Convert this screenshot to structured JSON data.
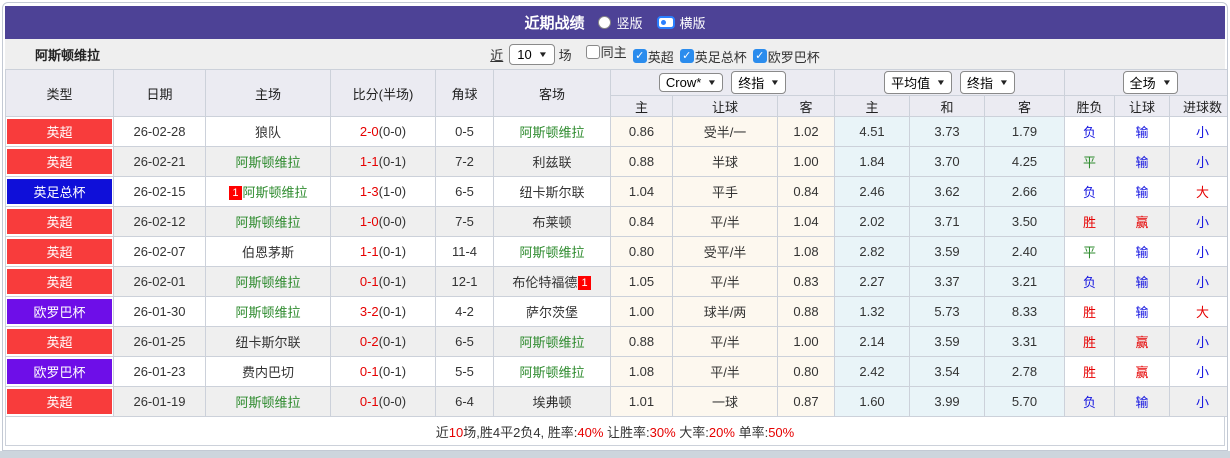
{
  "header": {
    "title": "近期战绩",
    "radios": [
      {
        "label": "竖版",
        "selected": false
      },
      {
        "label": "横版",
        "selected": true
      }
    ]
  },
  "filter": {
    "team": "阿斯顿维拉",
    "near_label": "近",
    "match_count": "10",
    "games_label": "场",
    "checkboxes": [
      {
        "label": "同主",
        "checked": false
      },
      {
        "label": "英超",
        "checked": true
      },
      {
        "label": "英足总杯",
        "checked": true
      },
      {
        "label": "欧罗巴杯",
        "checked": true
      }
    ]
  },
  "table": {
    "main_headers": [
      "类型",
      "日期",
      "主场",
      "比分(半场)",
      "角球",
      "客场"
    ],
    "selects": [
      {
        "label": "Crow*"
      },
      {
        "label": "终指"
      },
      {
        "label": "平均值"
      },
      {
        "label": "终指"
      },
      {
        "label": "全场"
      }
    ],
    "sub_headers": [
      "主",
      "让球",
      "客",
      "主",
      "和",
      "客",
      "胜负",
      "让球",
      "进球数"
    ],
    "rows": [
      {
        "type": "英超",
        "date": "26-02-28",
        "home": {
          "name": "狼队",
          "villa": false,
          "card": null
        },
        "score": {
          "ft": "2-0",
          "ht": "(0-0)"
        },
        "corner": "0-5",
        "away": {
          "name": "阿斯顿维拉",
          "villa": true,
          "card": null
        },
        "crow": [
          "0.86",
          "受半/一",
          "1.02"
        ],
        "avg": [
          "4.51",
          "3.73",
          "1.79"
        ],
        "result": [
          {
            "t": "负",
            "c": "blue"
          },
          {
            "t": "输",
            "c": "blue"
          },
          {
            "t": "小",
            "c": "blue"
          }
        ]
      },
      {
        "type": "英超",
        "date": "26-02-21",
        "home": {
          "name": "阿斯顿维拉",
          "villa": true,
          "card": null
        },
        "score": {
          "ft": "1-1",
          "ht": "(0-1)"
        },
        "corner": "7-2",
        "away": {
          "name": "利兹联",
          "villa": false,
          "card": null
        },
        "crow": [
          "0.88",
          "半球",
          "1.00"
        ],
        "avg": [
          "1.84",
          "3.70",
          "4.25"
        ],
        "result": [
          {
            "t": "平",
            "c": "green"
          },
          {
            "t": "输",
            "c": "blue"
          },
          {
            "t": "小",
            "c": "blue"
          }
        ]
      },
      {
        "type": "英足总杯",
        "date": "26-02-15",
        "home": {
          "name": "阿斯顿维拉",
          "villa": true,
          "card": "1"
        },
        "score": {
          "ft": "1-3",
          "ht": "(1-0)"
        },
        "corner": "6-5",
        "away": {
          "name": "纽卡斯尔联",
          "villa": false,
          "card": null
        },
        "crow": [
          "1.04",
          "平手",
          "0.84"
        ],
        "avg": [
          "2.46",
          "3.62",
          "2.66"
        ],
        "result": [
          {
            "t": "负",
            "c": "blue"
          },
          {
            "t": "输",
            "c": "blue"
          },
          {
            "t": "大",
            "c": "red"
          }
        ]
      },
      {
        "type": "英超",
        "date": "26-02-12",
        "home": {
          "name": "阿斯顿维拉",
          "villa": true,
          "card": null
        },
        "score": {
          "ft": "1-0",
          "ht": "(0-0)"
        },
        "corner": "7-5",
        "away": {
          "name": "布莱顿",
          "villa": false,
          "card": null
        },
        "crow": [
          "0.84",
          "平/半",
          "1.04"
        ],
        "avg": [
          "2.02",
          "3.71",
          "3.50"
        ],
        "result": [
          {
            "t": "胜",
            "c": "red"
          },
          {
            "t": "赢",
            "c": "red"
          },
          {
            "t": "小",
            "c": "blue"
          }
        ]
      },
      {
        "type": "英超",
        "date": "26-02-07",
        "home": {
          "name": "伯恩茅斯",
          "villa": false,
          "card": null
        },
        "score": {
          "ft": "1-1",
          "ht": "(0-1)"
        },
        "corner": "11-4",
        "away": {
          "name": "阿斯顿维拉",
          "villa": true,
          "card": null
        },
        "crow": [
          "0.80",
          "受平/半",
          "1.08"
        ],
        "avg": [
          "2.82",
          "3.59",
          "2.40"
        ],
        "result": [
          {
            "t": "平",
            "c": "green"
          },
          {
            "t": "输",
            "c": "blue"
          },
          {
            "t": "小",
            "c": "blue"
          }
        ]
      },
      {
        "type": "英超",
        "date": "26-02-01",
        "home": {
          "name": "阿斯顿维拉",
          "villa": true,
          "card": null
        },
        "score": {
          "ft": "0-1",
          "ht": "(0-1)"
        },
        "corner": "12-1",
        "away": {
          "name": "布伦特福德",
          "villa": false,
          "card": "1"
        },
        "crow": [
          "1.05",
          "平/半",
          "0.83"
        ],
        "avg": [
          "2.27",
          "3.37",
          "3.21"
        ],
        "result": [
          {
            "t": "负",
            "c": "blue"
          },
          {
            "t": "输",
            "c": "blue"
          },
          {
            "t": "小",
            "c": "blue"
          }
        ]
      },
      {
        "type": "欧罗巴杯",
        "date": "26-01-30",
        "home": {
          "name": "阿斯顿维拉",
          "villa": true,
          "card": null
        },
        "score": {
          "ft": "3-2",
          "ht": "(0-1)"
        },
        "corner": "4-2",
        "away": {
          "name": "萨尔茨堡",
          "villa": false,
          "card": null
        },
        "crow": [
          "1.00",
          "球半/两",
          "0.88"
        ],
        "avg": [
          "1.32",
          "5.73",
          "8.33"
        ],
        "result": [
          {
            "t": "胜",
            "c": "red"
          },
          {
            "t": "输",
            "c": "blue"
          },
          {
            "t": "大",
            "c": "red"
          }
        ]
      },
      {
        "type": "英超",
        "date": "26-01-25",
        "home": {
          "name": "纽卡斯尔联",
          "villa": false,
          "card": null
        },
        "score": {
          "ft": "0-2",
          "ht": "(0-1)"
        },
        "corner": "6-5",
        "away": {
          "name": "阿斯顿维拉",
          "villa": true,
          "card": null
        },
        "crow": [
          "0.88",
          "平/半",
          "1.00"
        ],
        "avg": [
          "2.14",
          "3.59",
          "3.31"
        ],
        "result": [
          {
            "t": "胜",
            "c": "red"
          },
          {
            "t": "赢",
            "c": "red"
          },
          {
            "t": "小",
            "c": "blue"
          }
        ]
      },
      {
        "type": "欧罗巴杯",
        "date": "26-01-23",
        "home": {
          "name": "费内巴切",
          "villa": false,
          "card": null
        },
        "score": {
          "ft": "0-1",
          "ht": "(0-1)"
        },
        "corner": "5-5",
        "away": {
          "name": "阿斯顿维拉",
          "villa": true,
          "card": null
        },
        "crow": [
          "1.08",
          "平/半",
          "0.80"
        ],
        "avg": [
          "2.42",
          "3.54",
          "2.78"
        ],
        "result": [
          {
            "t": "胜",
            "c": "red"
          },
          {
            "t": "赢",
            "c": "red"
          },
          {
            "t": "小",
            "c": "blue"
          }
        ]
      },
      {
        "type": "英超",
        "date": "26-01-19",
        "home": {
          "name": "阿斯顿维拉",
          "villa": true,
          "card": null
        },
        "score": {
          "ft": "0-1",
          "ht": "(0-0)"
        },
        "corner": "6-4",
        "away": {
          "name": "埃弗顿",
          "villa": false,
          "card": null
        },
        "crow": [
          "1.01",
          "一球",
          "0.87"
        ],
        "avg": [
          "1.60",
          "3.99",
          "5.70"
        ],
        "result": [
          {
            "t": "负",
            "c": "blue"
          },
          {
            "t": "输",
            "c": "blue"
          },
          {
            "t": "小",
            "c": "blue"
          }
        ]
      }
    ]
  },
  "summary": {
    "segments": [
      {
        "t": "近",
        "red": false
      },
      {
        "t": "10",
        "red": true
      },
      {
        "t": "场,胜4平2负4, 胜率:",
        "red": false
      },
      {
        "t": "40%",
        "red": true
      },
      {
        "t": " 让胜率:",
        "red": false
      },
      {
        "t": "30%",
        "red": true
      },
      {
        "t": " 大率:",
        "red": false
      },
      {
        "t": "20%",
        "red": true
      },
      {
        "t": " 单率:",
        "red": false
      },
      {
        "t": "50%",
        "red": true
      }
    ]
  },
  "colors": {
    "titlebar_bg": "#4d4296",
    "league": {
      "英超": "#f83c3c",
      "英足总杯": "#0f0fd9",
      "欧罗巴杯": "#6e0ee8"
    },
    "win_red": "#e60000",
    "draw_green": "#2e8b2e",
    "lose_blue": "#1414e0",
    "villa_green": "#2e8b2e",
    "score_red": "#e60000",
    "checkbox_blue": "#2b8ced",
    "cream_bg": "#fdf8ef",
    "cyan_bg": "#e9f4f8"
  }
}
